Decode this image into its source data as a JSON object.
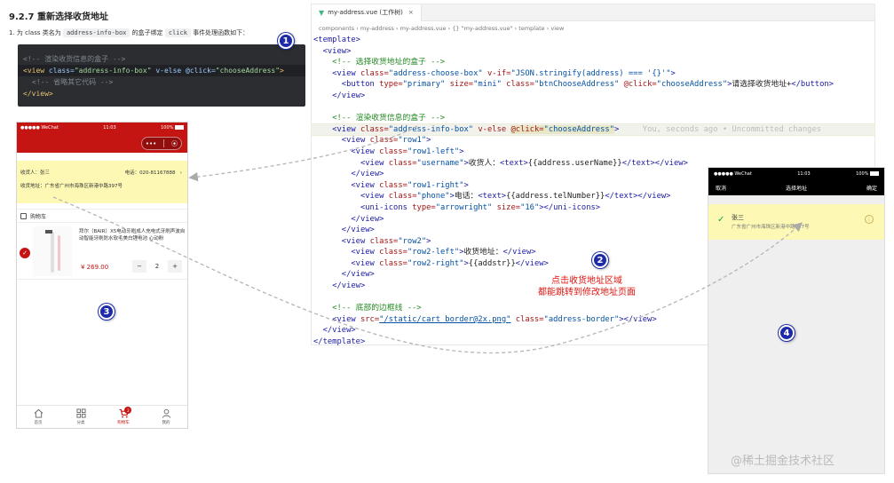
{
  "doc": {
    "heading": "9.2.7 重新选择收货地址",
    "desc_prefix": "1. 为 class 类名为",
    "desc_chip1": "address-info-box",
    "desc_mid": "的盒子绑定",
    "desc_chip2": "click",
    "desc_suffix": "事件处理函数如下：",
    "snippet": {
      "l1": "<!-- 渲染收货信息的盒子 -->",
      "l2_tag": "<view",
      "l2_attr1": " class=",
      "l2_val1": "\"address-info-box\"",
      "l2_attr2": " v-else @click=",
      "l2_val2": "\"chooseAddress\"",
      "l2_end": ">",
      "l3": "<!-- 省略其它代码 -->",
      "l4": "</view>"
    }
  },
  "markers": {
    "m1": "1",
    "m2": "2",
    "m3": "3",
    "m4": "4"
  },
  "phone1": {
    "carrier": "●●●●● WeChat",
    "time": "11:03",
    "battery": "100%",
    "capsule_more": "•••",
    "capsule_close": "⦿",
    "receiver": "收货人：张三",
    "phone": "电话：020-81167888",
    "chevron": "›",
    "address": "收货地址：广东省广州市海珠区新港中路397号",
    "cart_title": "购物车",
    "goods_title": "拜尔（BAIR）X5电动牙刷成人充电式牙刷声波自动智能牙刷防水软毛美白锂电池 心动粉",
    "goods_price": "¥ 269.00",
    "stepper_minus": "−",
    "stepper_count": "2",
    "stepper_plus": "+",
    "tabs": [
      {
        "label": "首页"
      },
      {
        "label": "分类"
      },
      {
        "label": "购物车"
      },
      {
        "label": "我的"
      }
    ],
    "cart_badge": "2"
  },
  "editor": {
    "tab_title": "my-address.vue (工作树)",
    "tab_close": "×",
    "breadcrumb": "components › my-address › my-address.vue › {} \"my-address.vue\" › template › view"
  },
  "callout": {
    "line1": "点击收货地址区域",
    "line2": "都能跳转到修改地址页面"
  },
  "phone2": {
    "carrier": "●●●●● WeChat",
    "time": "11:03",
    "battery": "100%",
    "cancel": "取消",
    "title": "选择地址",
    "confirm": "确定",
    "check": "✓",
    "name": "张三",
    "address": "广东省广州市海珠区新港中路397号",
    "info": "i"
  },
  "watermark": "@稀土掘金技术社区",
  "colors": {
    "wechat_red": "#c41513",
    "highlight_yellow": "#fdf9b5",
    "marker_blue": "#1d2ba8",
    "callout_red": "#e1140f"
  }
}
